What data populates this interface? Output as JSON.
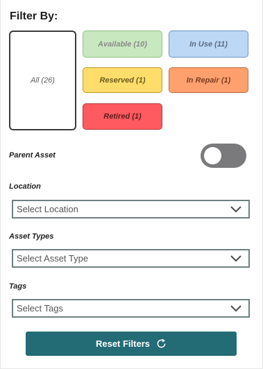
{
  "filter": {
    "title": "Filter By:",
    "statuses": {
      "all": "All (26)",
      "available": "Available (10)",
      "in_use": "In Use (11)",
      "reserved": "Reserved (1)",
      "in_repair": "In Repair (1)",
      "retired": "Retired (1)"
    }
  },
  "parent_asset": {
    "label": "Parent Asset",
    "toggle_on": false
  },
  "location": {
    "label": "Location",
    "placeholder": "Select Location"
  },
  "asset_types": {
    "label": "Asset Types",
    "placeholder": "Select Asset Type"
  },
  "tags": {
    "label": "Tags",
    "placeholder": "Select Tags"
  },
  "reset": {
    "label": "Reset Filters",
    "icon": "refresh-icon"
  },
  "colors": {
    "available": "#c8e8c0",
    "in_use": "#bcd8f4",
    "reserved": "#ffdd6b",
    "in_repair": "#ffa06e",
    "retired": "#ff5a5f",
    "toggle_off": "#7a7a7c",
    "reset_button": "#236b75"
  }
}
